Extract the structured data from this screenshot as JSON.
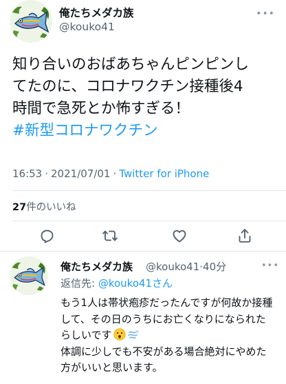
{
  "main_tweet": {
    "display_name": "俺たちメダカ族",
    "handle": "@kouko41",
    "more_icon": "ellipsis-icon",
    "text_lines": [
      "知り合いのおばあちゃんピンピンし",
      "てたのに、コロナワクチン接種後4",
      "時間で急死とか怖すぎる！"
    ],
    "hashtag": "#新型コロナワクチン",
    "time": "16:53",
    "separator": "·",
    "date": "2021/07/01",
    "source": "Twitter for iPhone",
    "like_count": "27",
    "like_label": "件のいいね",
    "actions": {
      "reply_icon": "reply-icon",
      "retweet_icon": "retweet-icon",
      "like_icon": "heart-icon",
      "share_icon": "share-icon"
    }
  },
  "reply_tweet": {
    "display_name": "俺たちメダカ族",
    "handle": "@kouko41",
    "separator": "·",
    "time_ago": "40分",
    "more_icon": "ellipsis-icon",
    "reply_to_label": "返信先: ",
    "reply_to_mention": "@kouko41さん",
    "text_lines": [
      "もう1人は帯状疱疹だったんですが何故か接種",
      "して、その日のうちにお亡くなりになられた",
      "らしいです",
      "体調に少しでも不安がある場合絶対にやめた",
      "方がいいと思います。"
    ],
    "emojis": [
      "surprised-face-emoji",
      "dash-emoji"
    ]
  },
  "colors": {
    "accent": "#1d9bf0",
    "secondary_text": "#536471",
    "primary_text": "#0f1419",
    "divider": "#e1e6ea"
  }
}
